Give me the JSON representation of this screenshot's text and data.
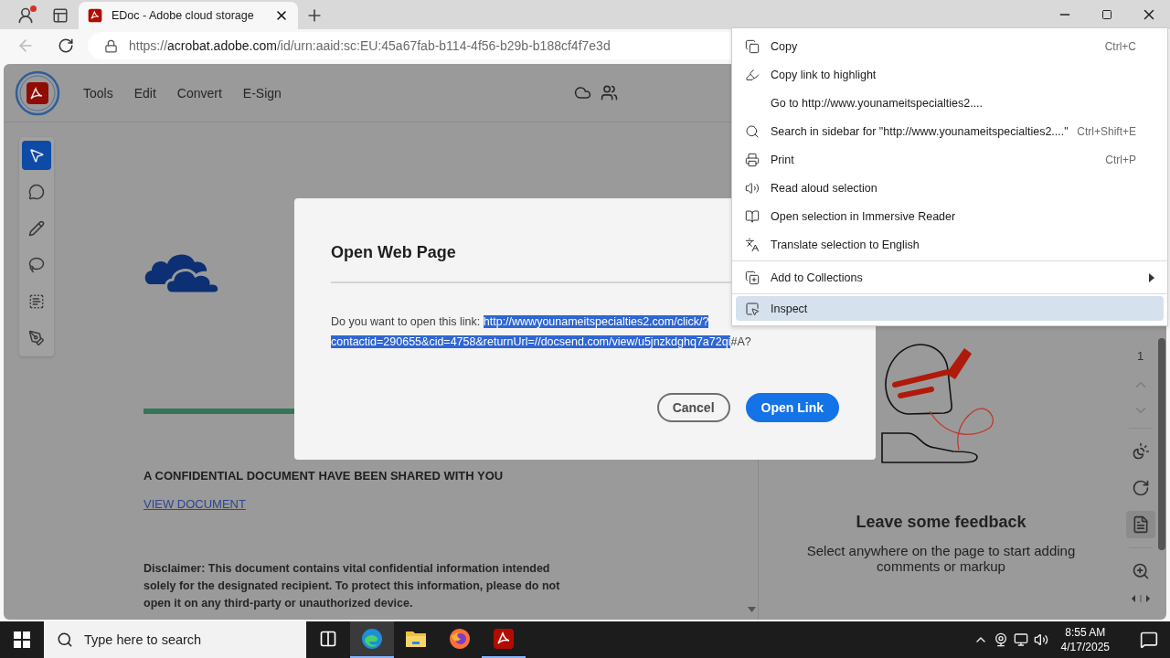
{
  "browser": {
    "tab": {
      "title": "EDoc - Adobe cloud storage"
    },
    "address": {
      "scheme": "https://",
      "host": "acrobat.adobe.com",
      "path": "/id/urn:aaid:sc:EU:45a67fab-b114-4f56-b29b-b188cf4f7e3d"
    }
  },
  "app": {
    "nav": [
      {
        "label": "Tools"
      },
      {
        "label": "Edit"
      },
      {
        "label": "Convert"
      },
      {
        "label": "E-Sign"
      }
    ],
    "tools": [
      {
        "selected": true
      },
      {
        "selected": false
      },
      {
        "selected": false
      },
      {
        "selected": false
      },
      {
        "selected": false
      },
      {
        "selected": false
      }
    ],
    "document": {
      "heading": "A CONFIDENTIAL DOCUMENT HAVE BEEN SHARED WITH YOU",
      "link": "VIEW DOCUMENT",
      "disclaimer": "Disclaimer: This document contains vital confidential information intended solely for the designated recipient. To protect this information, please do not open it on any third-party or unauthorized device."
    },
    "feedback": {
      "title": "Leave some feedback",
      "text": "Select anywhere on the page to start adding comments or markup"
    },
    "page_number": "1",
    "rail": [
      {
        "selected": false
      },
      {
        "selected": false
      },
      {
        "selected": true
      },
      {
        "selected": false
      }
    ]
  },
  "dialog": {
    "title": "Open Web Page",
    "prompt": "Do you want to open this link:",
    "link_selected": "http://wwwyounameitspecialties2.com/click/?contactid=290655&cid=4758&returnUrl=//docsend.com/view/u5jnzkdghq7a72qi",
    "link_rest": "#A?",
    "buttons": [
      {
        "label": "Cancel",
        "kind": "secondary"
      },
      {
        "label": "Open Link",
        "kind": "primary"
      }
    ]
  },
  "context_menu": {
    "groups": [
      [
        {
          "label": "Copy",
          "shortcut": "Ctrl+C",
          "has_submenu": false,
          "selected": false
        },
        {
          "label": "Copy link to highlight",
          "has_submenu": false,
          "selected": false
        },
        {
          "label": "Go to http://www.younameitspecialties2....",
          "has_submenu": false,
          "selected": false
        },
        {
          "label": "Search in sidebar for \"http://www.younameitspecialties2....\"",
          "shortcut": "Ctrl+Shift+E",
          "has_submenu": false,
          "selected": false
        },
        {
          "label": "Print",
          "shortcut": "Ctrl+P",
          "has_submenu": false,
          "selected": false
        },
        {
          "label": "Read aloud selection",
          "has_submenu": false,
          "selected": false
        },
        {
          "label": "Open selection in Immersive Reader",
          "has_submenu": false,
          "selected": false
        },
        {
          "label": "Translate selection to English",
          "has_submenu": false,
          "selected": false
        }
      ],
      [
        {
          "label": "Add to Collections",
          "has_submenu": true,
          "selected": false
        }
      ],
      [
        {
          "label": "Inspect",
          "has_submenu": false,
          "selected": true
        }
      ]
    ]
  },
  "taskbar": {
    "search": {
      "placeholder": "Type here to search"
    },
    "apps": [
      {
        "selected": true,
        "running": true
      },
      {
        "selected": false,
        "running": false
      },
      {
        "selected": false,
        "running": false
      },
      {
        "selected": false,
        "running": true
      }
    ],
    "clock": {
      "time": "8:55 AM",
      "date": "4/17/2025"
    }
  }
}
